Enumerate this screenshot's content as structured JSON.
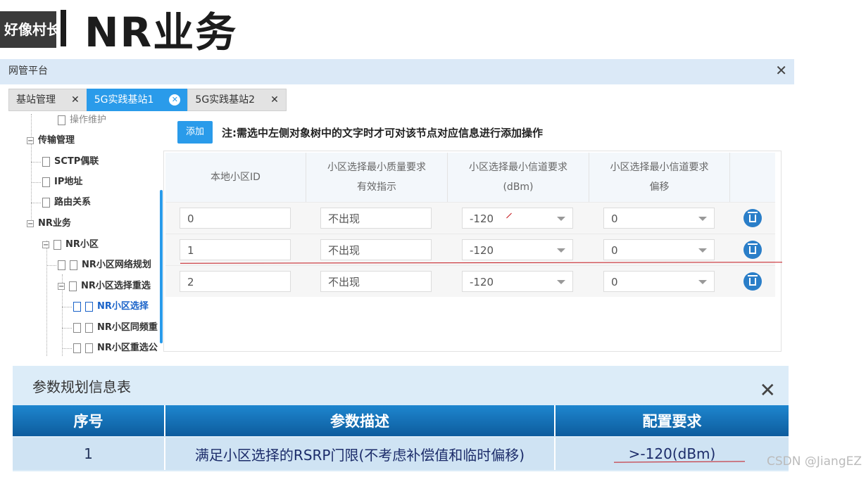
{
  "watermark": "好像村长",
  "page_title": "NR业务",
  "window": {
    "title": "网管平台"
  },
  "tabs": [
    {
      "label": "基站管理",
      "active": false
    },
    {
      "label": "5G实践基站1",
      "active": true
    },
    {
      "label": "5G实践基站2",
      "active": false
    }
  ],
  "tree": {
    "partial_top": "操作维护",
    "transport": "传输管理",
    "sctp": "SCTP偶联",
    "ip": "IP地址",
    "route": "路由关系",
    "nr_service": "NR业务",
    "nr_cell": "NR小区",
    "nr_plan": "NR小区网络规划",
    "nr_resel": "NR小区选择重选",
    "nr_select": "NR小区选择",
    "nr_intra": "NR小区同频重",
    "nr_resel_common": "NR小区重选公"
  },
  "toolbar": {
    "add_label": "添加",
    "note": "注:需选中左侧对象树中的文字时才可对该节点对应信息进行添加操作"
  },
  "grid": {
    "headers": [
      {
        "line1": "本地小区ID",
        "line2": ""
      },
      {
        "line1": "小区选择最小质量要求",
        "line2": "有效指示"
      },
      {
        "line1": "小区选择最小信道要求",
        "line2": "(dBm)"
      },
      {
        "line1": "小区选择最小信道要求",
        "line2": "偏移"
      }
    ],
    "rows": [
      {
        "cell_id": "0",
        "quality": "不出现",
        "rxlev": "-120",
        "offset": "0"
      },
      {
        "cell_id": "1",
        "quality": "不出现",
        "rxlev": "-120",
        "offset": "0"
      },
      {
        "cell_id": "2",
        "quality": "不出现",
        "rxlev": "-120",
        "offset": "0"
      }
    ]
  },
  "param_table": {
    "title": "参数规划信息表",
    "headers": {
      "no": "序号",
      "desc": "参数描述",
      "req": "配置要求"
    },
    "rows": [
      {
        "no": "1",
        "desc": "满足小区选择的RSRP门限(不考虑补偿值和临时偏移)",
        "req": ">-120(dBm)"
      }
    ]
  },
  "credit": "CSDN @JiangEZ",
  "colors": {
    "accent": "#2a9bea",
    "header_blue": "#1e86cf",
    "annotation_red": "#c4151c"
  }
}
